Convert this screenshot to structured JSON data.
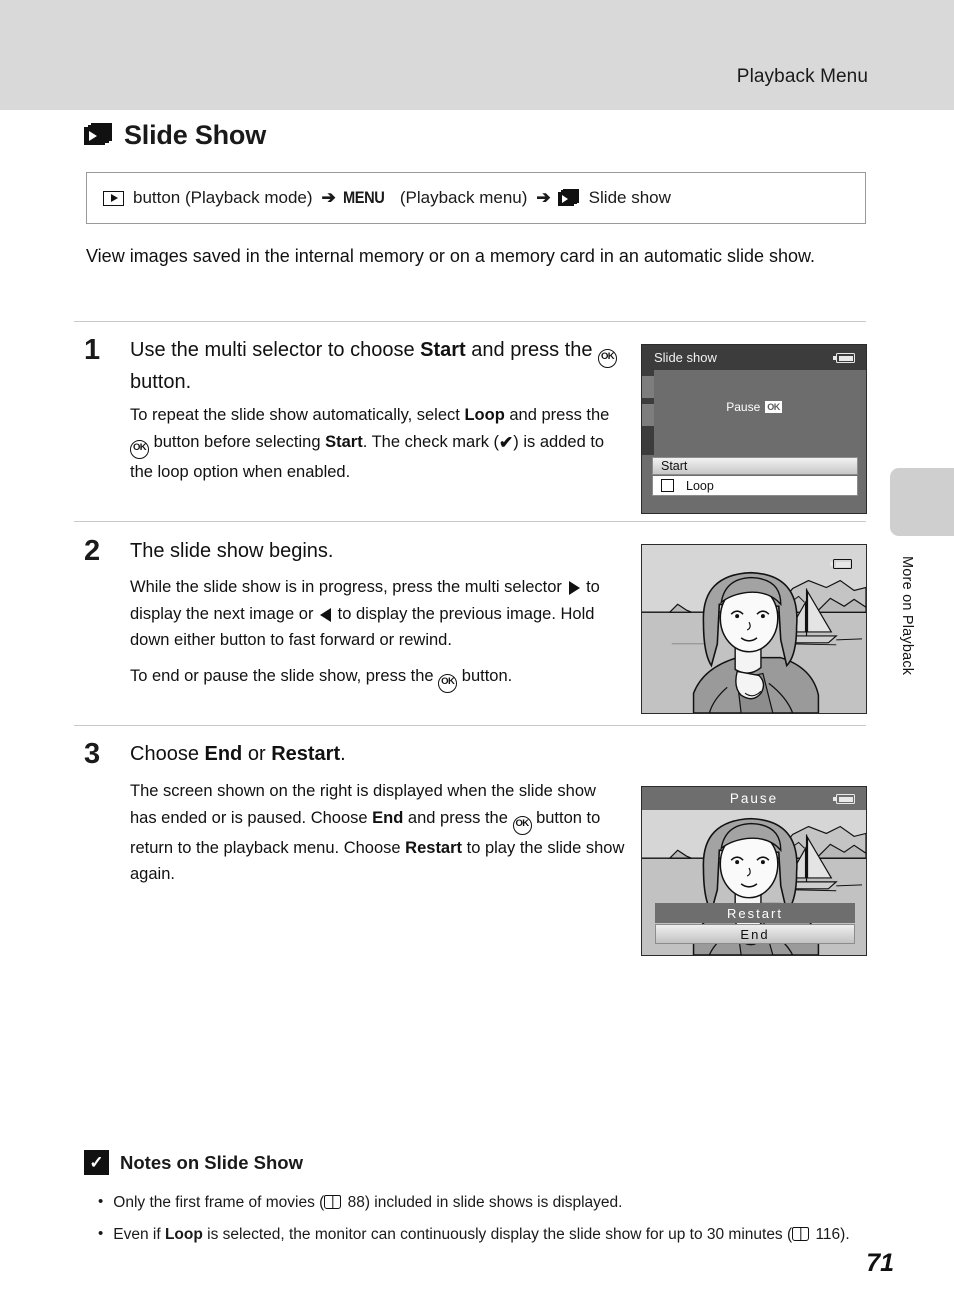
{
  "header": {
    "title": "Playback Menu"
  },
  "side_tab": {
    "label": "More on Playback"
  },
  "heading": {
    "icon": "slideshow-stack-icon",
    "title": "Slide Show"
  },
  "nav_path": {
    "play_icon": "playback-button-icon",
    "part1": "button (Playback mode)",
    "arrow1": "➔",
    "menu_label": "MENU",
    "part2": "(Playback menu)",
    "arrow2": "➔",
    "slideshow_icon": "slideshow-stack-icon",
    "part3": "Slide show"
  },
  "intro": "View images saved in the internal memory or on a memory card in an automatic slide show.",
  "steps": [
    {
      "number": "1",
      "title_pre": "Use the multi selector to choose ",
      "title_bold": "Start",
      "title_mid": " and press the ",
      "title_ok": "OK",
      "title_post": " button.",
      "body_lines": [
        {
          "segments": [
            {
              "t": "To repeat the slide show automatically, select ",
              "b": false
            },
            {
              "t": "Loop",
              "b": true
            },
            {
              "t": " and press the ",
              "b": false
            },
            {
              "t": "[OK]",
              "b": false,
              "glyph": "ok"
            },
            {
              "t": " button before selecting ",
              "b": false
            },
            {
              "t": "Start",
              "b": true
            },
            {
              "t": ". The check mark (",
              "b": false
            },
            {
              "t": "[check]",
              "b": false,
              "glyph": "check"
            },
            {
              "t": ") is added to the loop option when enabled.",
              "b": false
            }
          ]
        }
      ]
    },
    {
      "number": "2",
      "title_plain": "The slide show begins.",
      "body_lines": [
        {
          "segments": [
            {
              "t": "While the slide show is in progress, press the multi selector ",
              "b": false
            },
            {
              "t": "[right]",
              "b": false,
              "glyph": "tri-right"
            },
            {
              "t": " to display the next image or ",
              "b": false
            },
            {
              "t": "[left]",
              "b": false,
              "glyph": "tri-left"
            },
            {
              "t": " to display the previous image. Hold down either button to fast forward or rewind.",
              "b": false
            }
          ]
        },
        {
          "segments": [
            {
              "t": "To end or pause the slide show, press the ",
              "b": false
            },
            {
              "t": "[OK]",
              "b": false,
              "glyph": "ok"
            },
            {
              "t": " button.",
              "b": false
            }
          ]
        }
      ]
    },
    {
      "number": "3",
      "title_pre": "Choose ",
      "title_bold": "End",
      "title_mid": " or ",
      "title_bold2": "Restart",
      "title_post2": ".",
      "body_lines": [
        {
          "segments": [
            {
              "t": "The screen shown on the right is displayed when the slide show has ended or is paused. Choose ",
              "b": false
            },
            {
              "t": "End",
              "b": true
            },
            {
              "t": " and press the ",
              "b": false
            },
            {
              "t": "[OK]",
              "b": false,
              "glyph": "ok"
            },
            {
              "t": " button to return to the playback menu. Choose ",
              "b": false
            },
            {
              "t": "Restart",
              "b": true
            },
            {
              "t": " to play the slide show again.",
              "b": false
            }
          ]
        }
      ]
    }
  ],
  "screen1": {
    "title": "Slide show",
    "battery_icon": "battery-icon",
    "pause_label": "Pause",
    "ok_badge": "OK",
    "start_label": "Start",
    "loop_label": "Loop",
    "checkbox_state": "unchecked"
  },
  "screen2": {
    "battery_icon": "battery-icon",
    "illustration": "woman-seaside-sailboat-illustration"
  },
  "screen3": {
    "title": "Pause",
    "battery_icon": "battery-icon",
    "restart_label": "Restart",
    "end_label": "End",
    "illustration": "woman-seaside-sailboat-illustration"
  },
  "notes": {
    "badge_icon": "caution-check-icon",
    "title": "Notes on Slide Show",
    "items": [
      {
        "segments": [
          {
            "t": "Only the first frame of movies (",
            "b": false
          },
          {
            "t": "[book]",
            "b": false,
            "glyph": "book"
          },
          {
            "t": " 88) included in slide shows is displayed.",
            "b": false
          }
        ]
      },
      {
        "segments": [
          {
            "t": "Even if ",
            "b": false
          },
          {
            "t": "Loop",
            "b": true
          },
          {
            "t": " is selected, the monitor can continuously display the slide show for up to 30 minutes (",
            "b": false
          },
          {
            "t": "[book]",
            "b": false,
            "glyph": "book"
          },
          {
            "t": " 116).",
            "b": false
          }
        ]
      }
    ]
  },
  "page_number": "71",
  "colors": {
    "header_band": "#d9d9d9",
    "side_tab": "#cfcfcf",
    "screen_bg": "#6d6d6d",
    "screen_titlebar": "#3c3c3c",
    "divider": "#c9c9c9"
  }
}
